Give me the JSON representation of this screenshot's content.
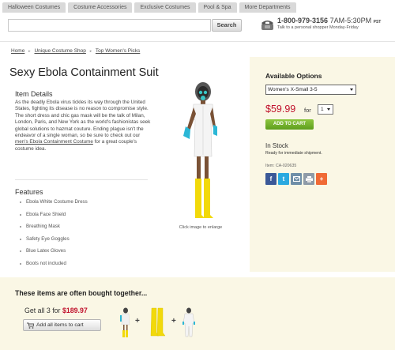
{
  "nav": {
    "tabs": [
      "Halloween Costumes",
      "Costume Accessories",
      "Exclusive Costumes",
      "Pool & Spa",
      "More Departments"
    ]
  },
  "search": {
    "placeholder": "",
    "button_label": "Search"
  },
  "phone": {
    "number": "1-800-979-3156",
    "hours": "7AM-5:30PM",
    "tz": "PST",
    "subtext": "Talk to a personal shopper Monday-Friday"
  },
  "breadcrumb": {
    "items": [
      "Home",
      "Unique Costume Shop",
      "Top Women's Picks"
    ]
  },
  "product": {
    "title": "Sexy Ebola Containment Suit",
    "details_heading": "Item Details",
    "description_before": "As the deadly Ebola virus tickles its way through the United States, fighting its disease is no reason to compromise style. The short dress and chic gas mask will be the talk of Milan, London, Paris, and New York as the world's fashionistas seek global solutions to hazmat couture. Ending plague isn't the endeavor of a single woman, so be sure to check out our ",
    "description_link": "men's Ebola Containment Costume",
    "description_after": " for a great couple's costume idea.",
    "features_heading": "Features",
    "features": [
      "Ebola White Costume Dress",
      "Ebola Face Shield",
      "Breathing Mask",
      "Safety Eye Goggles",
      "Blue Latex Gloves",
      "Boots not included"
    ],
    "image_caption": "Click image to enlarge"
  },
  "purchase": {
    "heading": "Available Options",
    "size_selected": "Women's X-Small 3-5",
    "price": "$59.99",
    "for_label": "for",
    "qty": "1",
    "add_to_cart": "ADD TO CART",
    "stock_status": "In Stock",
    "ready_text": "Ready for immediate shipment.",
    "item_number": "Item: CA-020635"
  },
  "share": {
    "icons": [
      "facebook-icon",
      "twitter-icon",
      "email-icon",
      "print-icon",
      "more-icon"
    ],
    "facebook_glyph": "f",
    "twitter_glyph": "t",
    "more_glyph": "+"
  },
  "bundle": {
    "heading": "These items are often bought together...",
    "get_all_text": "Get all 3 for",
    "price": "$189.97",
    "add_all_label": "Add all items to cart",
    "plus": "+"
  },
  "colors": {
    "price_red": "#c0102b",
    "panel_bg": "#faf7e5",
    "cart_green": "#6aad24",
    "facebook": "#3b5998",
    "twitter": "#2aa9e0"
  }
}
